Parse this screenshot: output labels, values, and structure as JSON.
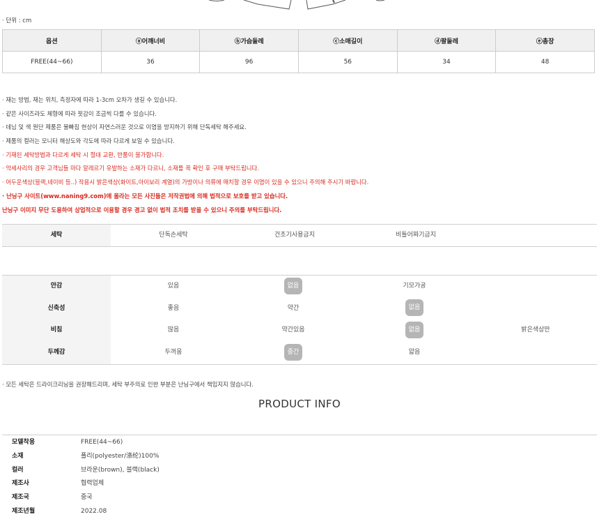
{
  "unit_label": "· 단위 : cm",
  "size_table": {
    "headers": [
      "옵션",
      "ⓐ어깨너비",
      "ⓑ가슴둘레",
      "ⓒ소매길이",
      "ⓓ팔둘레",
      "ⓔ총장"
    ],
    "rows": [
      [
        "FREE(44~66)",
        "36",
        "96",
        "56",
        "34",
        "48"
      ]
    ]
  },
  "notes": [
    {
      "text": "· 재는 방법, 재는 위치, 측정자에 따라 1-3cm 오차가 생길 수 있습니다.",
      "style": "normal"
    },
    {
      "text": "· 같은 사이즈라도 체형에 따라 핏감이 조금씩 다를 수 있습니다.",
      "style": "normal"
    },
    {
      "text": "· 데님 및 색 원단 제품은 물빠짐 현상이 자연스러운 것으로 이염을 방지하기 위해 단독세탁 해주세요.",
      "style": "normal"
    },
    {
      "text": "· 제품의 컬러는 모니터 해상도와 각도에 따라 다르게 보일 수 있습니다.",
      "style": "normal"
    },
    {
      "text": "· 기재된 세탁방법과 다르게 세탁 시 절대 교환, 반품이 불가합니다.",
      "style": "red"
    },
    {
      "text": "· 악세사리의 경우 고객님들 마다 알레르기 유발하는 소재가 다르니, 소재를 꼭 확인 후 구매 부탁드립니다.",
      "style": "red"
    },
    {
      "text": "· 어두운색상(블랙,네이비 등..) 작용시 밝은색상(화이트,아이보리 계열)의 가방이나 의류에 매치할 경우 이염이 있을 수 있으니 주의해 주시기 바랍니다.",
      "style": "red"
    },
    {
      "text": "· 난닝구 사이트(www.naning9.com)에 올라는 모든 사진들은 저작권법에 의해 법적으로 보호를 받고 있습니다.",
      "style": "red-bold"
    },
    {
      "text": "난닝구 이미지 무단 도용하여 상업적으로 이용할 경우 경고 없이 법적 조치를 받을 수 있으니 주의를 부탁드립니다.",
      "style": "red-bold"
    }
  ],
  "washing": {
    "label": "세탁",
    "options": [
      "단독손세탁",
      "건조기사용금지",
      "비틀어짜기금지"
    ]
  },
  "attributes": [
    {
      "label": "안감",
      "options": [
        "있음",
        "없음",
        "기모가공",
        ""
      ],
      "selected": 1
    },
    {
      "label": "신축성",
      "options": [
        "좋음",
        "약간",
        "없음",
        ""
      ],
      "selected": 2
    },
    {
      "label": "비침",
      "options": [
        "많음",
        "약간있음",
        "없음",
        "밝은색상만"
      ],
      "selected": 2
    },
    {
      "label": "두께감",
      "options": [
        "두꺼움",
        "중간",
        "얇음",
        ""
      ],
      "selected": 1
    }
  ],
  "disclaimer": "· 모든 세탁은 드라이크리닝을 권장해드리며, 세탁 부주의로 인한 부분은 난닝구에서 책임지지 않습니다.",
  "product_info": {
    "title": "PRODUCT INFO",
    "rows": [
      {
        "key": "모델착용",
        "value": "FREE(44~66)"
      },
      {
        "key": "소재",
        "value": "폴리(polyester/涤纶)100%"
      },
      {
        "key": "컬러",
        "value": "브라운(brown), 블랙(black)"
      },
      {
        "key": "제조사",
        "value": "협력업체"
      },
      {
        "key": "제조국",
        "value": "중국"
      },
      {
        "key": "제조년월",
        "value": "2022.08"
      }
    ]
  },
  "colors": {
    "warning_red": "#d9281e",
    "selected_badge": "#b5b5b5",
    "header_bg": "#f0f0f0",
    "border": "#cccccc"
  }
}
